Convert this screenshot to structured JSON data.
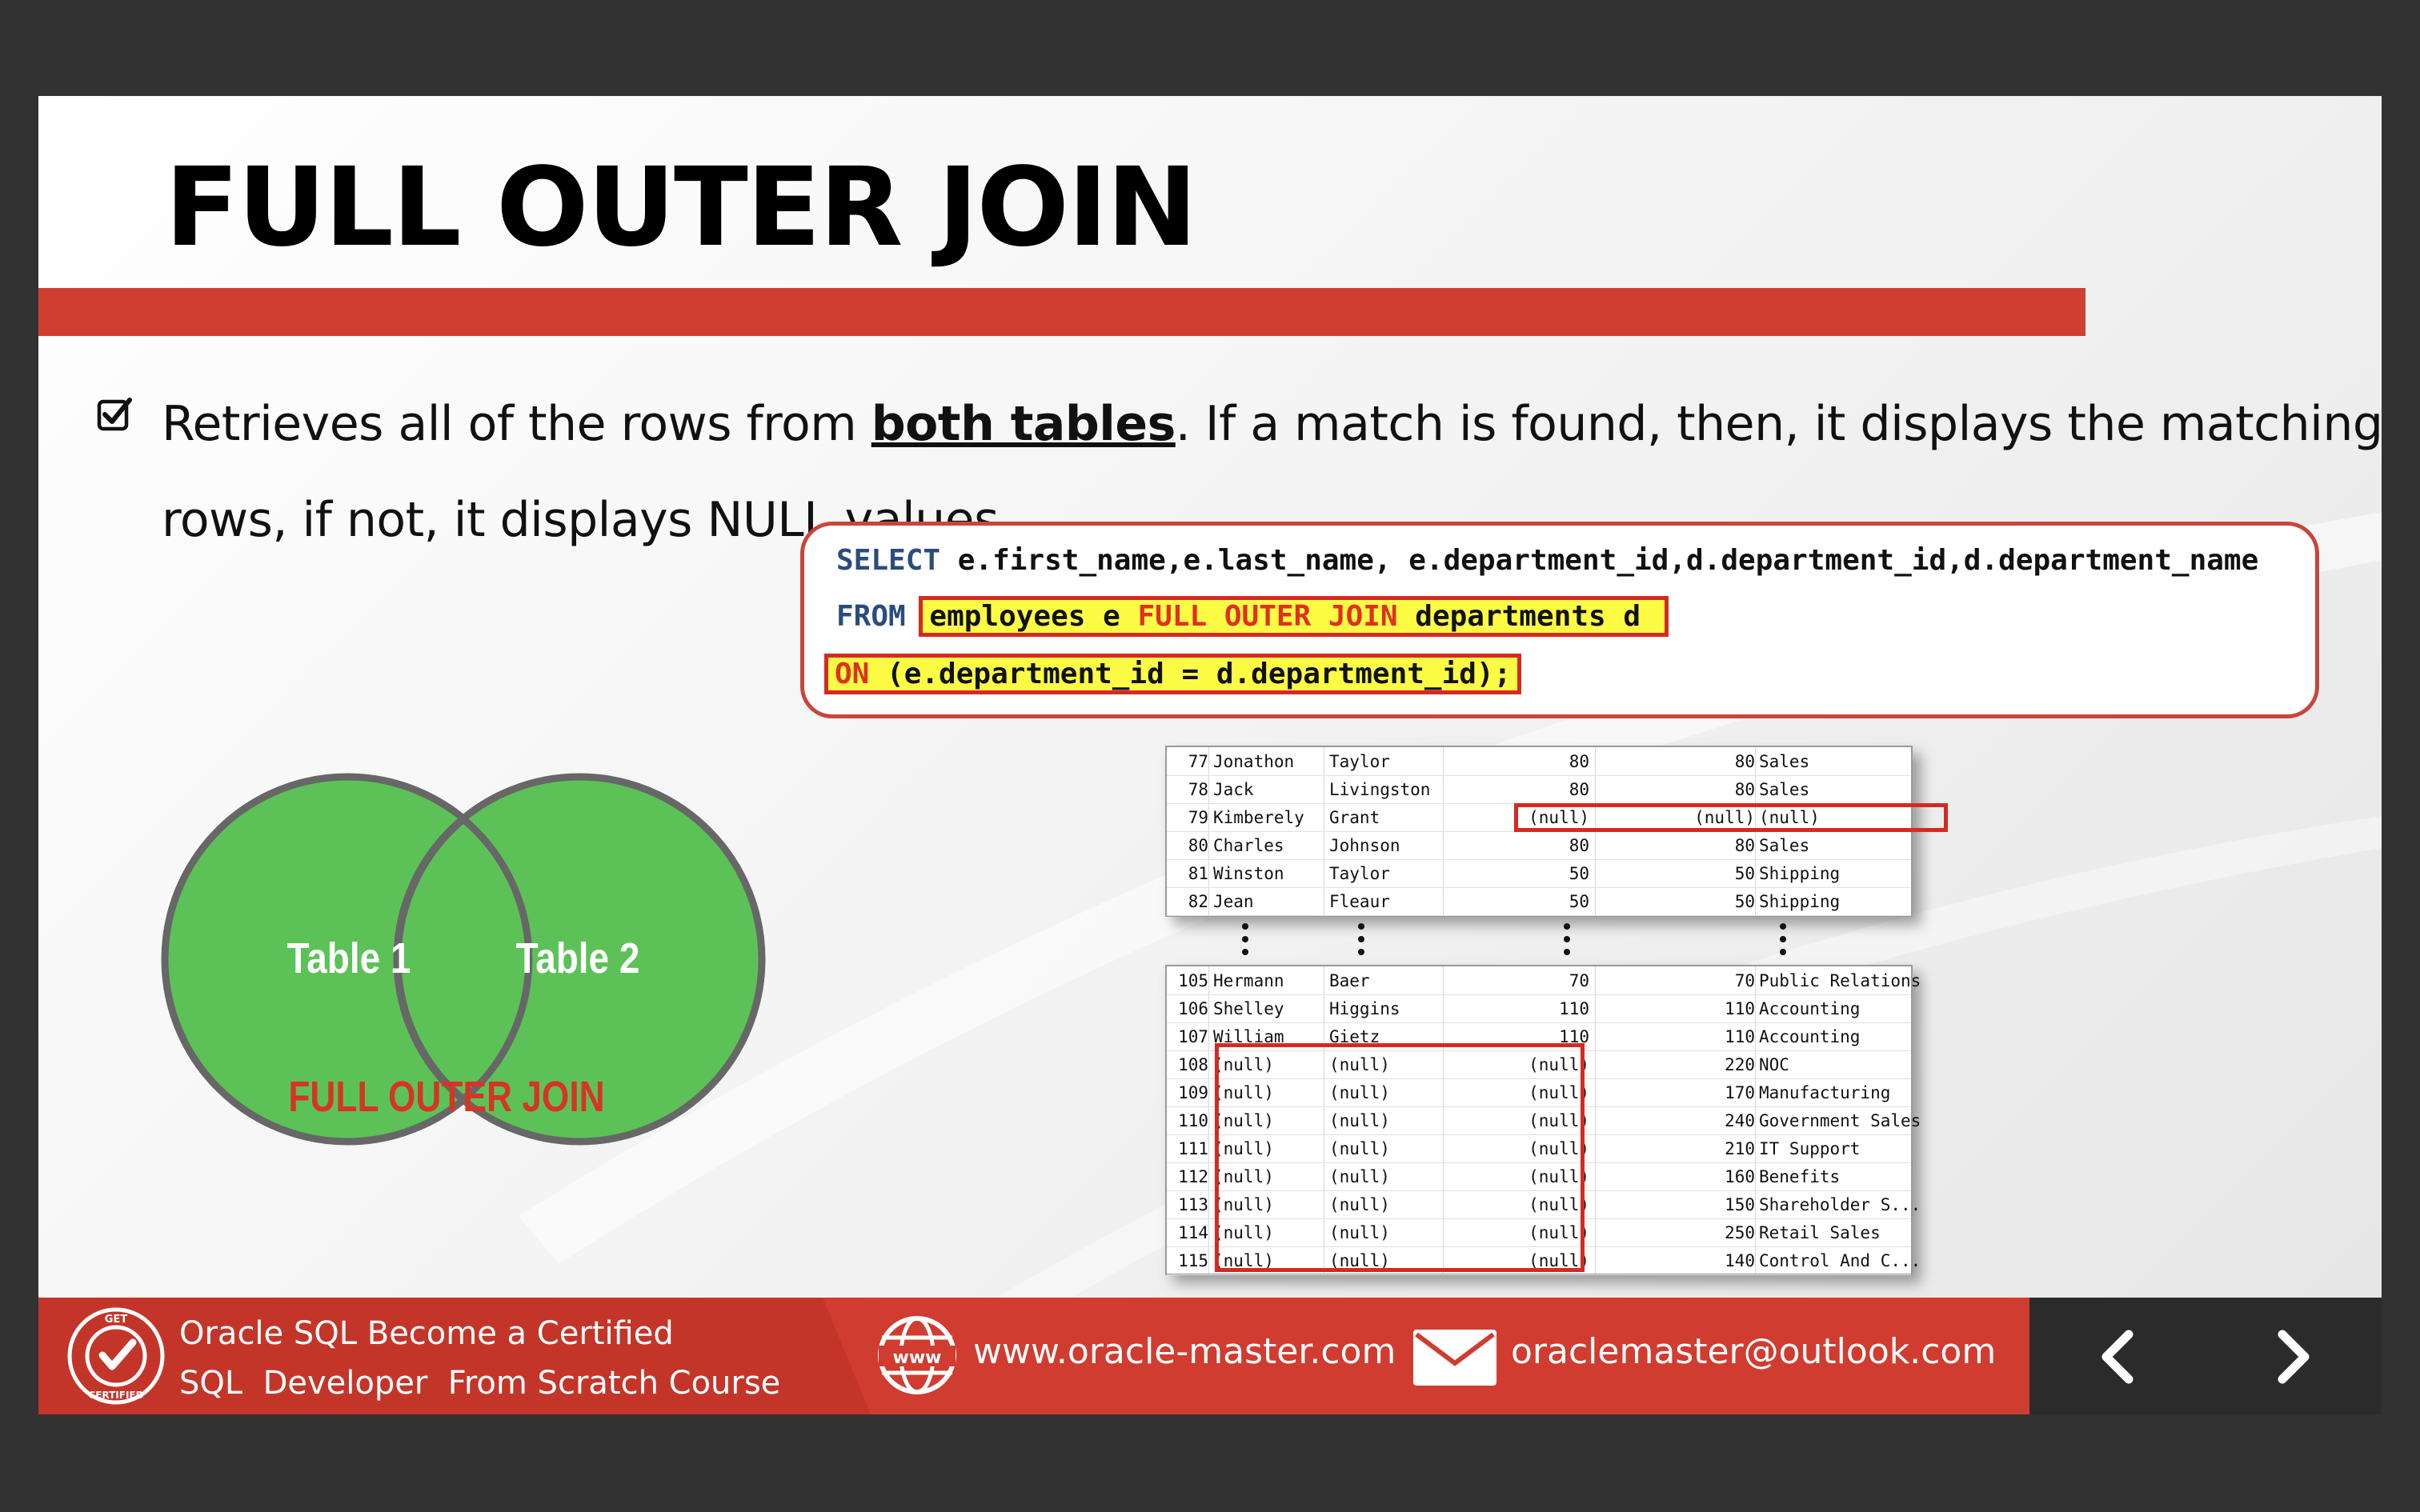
{
  "slide": {
    "title": "FULL OUTER JOIN",
    "bullet": {
      "before": "Retrieves all of the rows from ",
      "emphasis": "both tables",
      "after": ". If a match is found, then, it displays the matching rows, if not, it displays NULL values."
    }
  },
  "code": {
    "line1_kw": "SELECT",
    "line1_rest": " e.first_name,e.last_name, e.department_id,d.department_id,d.department_name",
    "line2_kw": "FROM",
    "line2_a": "employees e ",
    "line2_join": "FULL OUTER JOIN",
    "line2_b": " departments d ",
    "line3_kw": "ON",
    "line3_rest": " (e.department_id = d.department_id);"
  },
  "venn": {
    "left_label": "Table 1",
    "right_label": "Table 2",
    "caption": "FULL OUTER JOIN",
    "fill_color": "#5cc257",
    "stroke_color": "#676767"
  },
  "results_top": {
    "rows": [
      {
        "num": "77",
        "first": "Jonathon",
        "last": "Taylor",
        "e_dept": "80",
        "d_dept": "80",
        "dname": "Sales"
      },
      {
        "num": "78",
        "first": "Jack",
        "last": "Livingston",
        "e_dept": "80",
        "d_dept": "80",
        "dname": "Sales"
      },
      {
        "num": "79",
        "first": "Kimberely",
        "last": "Grant",
        "e_dept": "(null)",
        "d_dept": "(null)",
        "dname": "(null)"
      },
      {
        "num": "80",
        "first": "Charles",
        "last": "Johnson",
        "e_dept": "80",
        "d_dept": "80",
        "dname": "Sales"
      },
      {
        "num": "81",
        "first": "Winston",
        "last": "Taylor",
        "e_dept": "50",
        "d_dept": "50",
        "dname": "Shipping"
      },
      {
        "num": "82",
        "first": "Jean",
        "last": "Fleaur",
        "e_dept": "50",
        "d_dept": "50",
        "dname": "Shipping"
      }
    ]
  },
  "results_bottom": {
    "rows": [
      {
        "num": "105",
        "first": "Hermann",
        "last": "Baer",
        "e_dept": "70",
        "d_dept": "70",
        "dname": "Public Relations"
      },
      {
        "num": "106",
        "first": "Shelley",
        "last": "Higgins",
        "e_dept": "110",
        "d_dept": "110",
        "dname": "Accounting"
      },
      {
        "num": "107",
        "first": "William",
        "last": "Gietz",
        "e_dept": "110",
        "d_dept": "110",
        "dname": "Accounting"
      },
      {
        "num": "108",
        "first": "(null)",
        "last": "(null)",
        "e_dept": "(null)",
        "d_dept": "220",
        "dname": "NOC"
      },
      {
        "num": "109",
        "first": "(null)",
        "last": "(null)",
        "e_dept": "(null)",
        "d_dept": "170",
        "dname": "Manufacturing"
      },
      {
        "num": "110",
        "first": "(null)",
        "last": "(null)",
        "e_dept": "(null)",
        "d_dept": "240",
        "dname": "Government Sales"
      },
      {
        "num": "111",
        "first": "(null)",
        "last": "(null)",
        "e_dept": "(null)",
        "d_dept": "210",
        "dname": "IT Support"
      },
      {
        "num": "112",
        "first": "(null)",
        "last": "(null)",
        "e_dept": "(null)",
        "d_dept": "160",
        "dname": "Benefits"
      },
      {
        "num": "113",
        "first": "(null)",
        "last": "(null)",
        "e_dept": "(null)",
        "d_dept": "150",
        "dname": "Shareholder S..."
      },
      {
        "num": "114",
        "first": "(null)",
        "last": "(null)",
        "e_dept": "(null)",
        "d_dept": "250",
        "dname": "Retail Sales"
      },
      {
        "num": "115",
        "first": "(null)",
        "last": "(null)",
        "e_dept": "(null)",
        "d_dept": "140",
        "dname": "Control And C..."
      }
    ]
  },
  "footer": {
    "course_line1": "Oracle SQL Become a Certified",
    "course_line2": "SQL  Developer  From Scratch Course",
    "website": "www.oracle-master.com",
    "email": "oraclemaster@outlook.com",
    "badge_top": "GET",
    "badge_bottom": "CERTIFIED",
    "globe_text": "www",
    "accent_color": "#d03c30"
  }
}
